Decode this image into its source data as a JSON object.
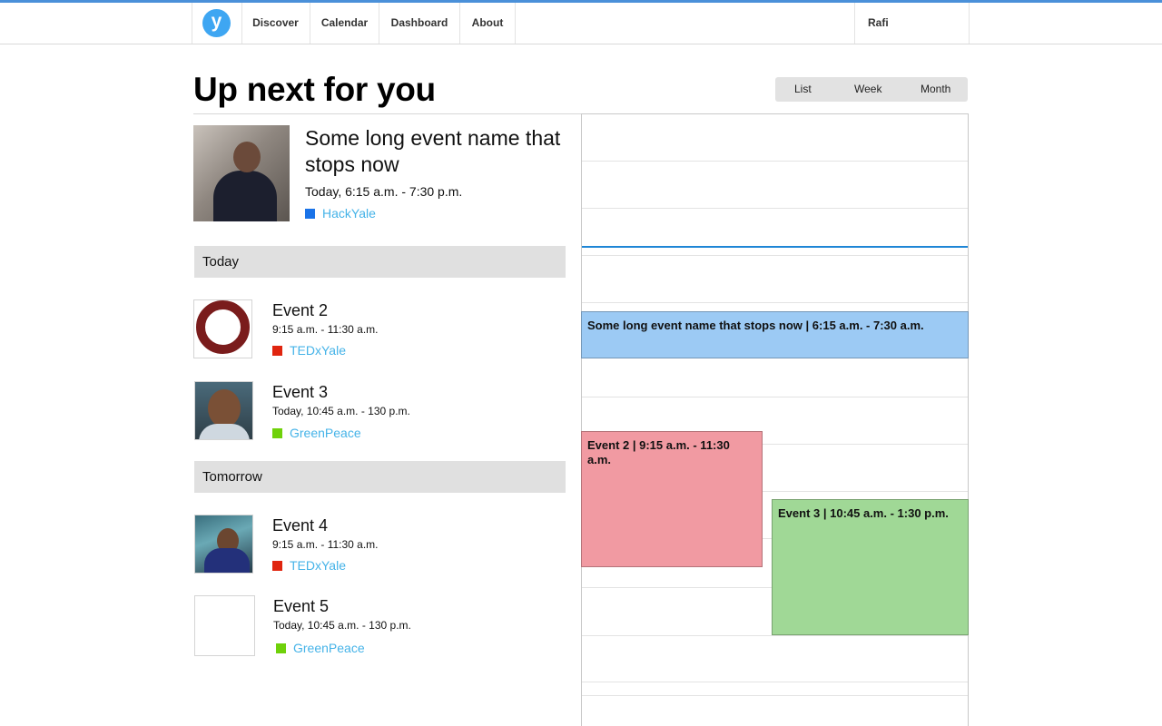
{
  "nav": {
    "logo_letter": "y",
    "items": [
      {
        "label": "Discover"
      },
      {
        "label": "Calendar"
      },
      {
        "label": "Dashboard"
      },
      {
        "label": "About"
      }
    ],
    "user": "Rafi"
  },
  "page": {
    "title": "Up next for you",
    "views": [
      "List",
      "Week",
      "Month"
    ]
  },
  "featured": {
    "title": "Some long event name that stops now",
    "time": "Today, 6:15 a.m. - 7:30 p.m.",
    "org": "HackYale",
    "org_color": "#1a73e8"
  },
  "sections": [
    {
      "heading": "Today",
      "events": [
        {
          "title": "Event 2",
          "time": "9:15 a.m. - 11:30 a.m.",
          "org": "TEDxYale",
          "org_color": "#e0250f"
        },
        {
          "title": "Event 3",
          "time": "Today, 10:45 a.m. - 130 p.m.",
          "org": "GreenPeace",
          "org_color": "#6fd10a"
        }
      ]
    },
    {
      "heading": "Tomorrow",
      "events": [
        {
          "title": "Event 4",
          "time": "9:15 a.m. - 11:30 a.m.",
          "org": "TEDxYale",
          "org_color": "#e0250f"
        },
        {
          "title": "Event 5",
          "time": "Today, 10:45 a.m. - 130 p.m.",
          "org": "GreenPeace",
          "org_color": "#6fd10a"
        }
      ]
    }
  ],
  "calendar": {
    "events": [
      {
        "label": "Some long event name that stops now  | 6:15 a.m. - 7:30 a.m.",
        "color": "#9ccaf4"
      },
      {
        "label": "Event 2 | 9:15 a.m. - 11:30 a.m.",
        "color": "#f19aa2"
      },
      {
        "label": "Event 3 | 10:45 a.m. - 1:30 p.m.",
        "color": "#a0d896"
      }
    ]
  }
}
